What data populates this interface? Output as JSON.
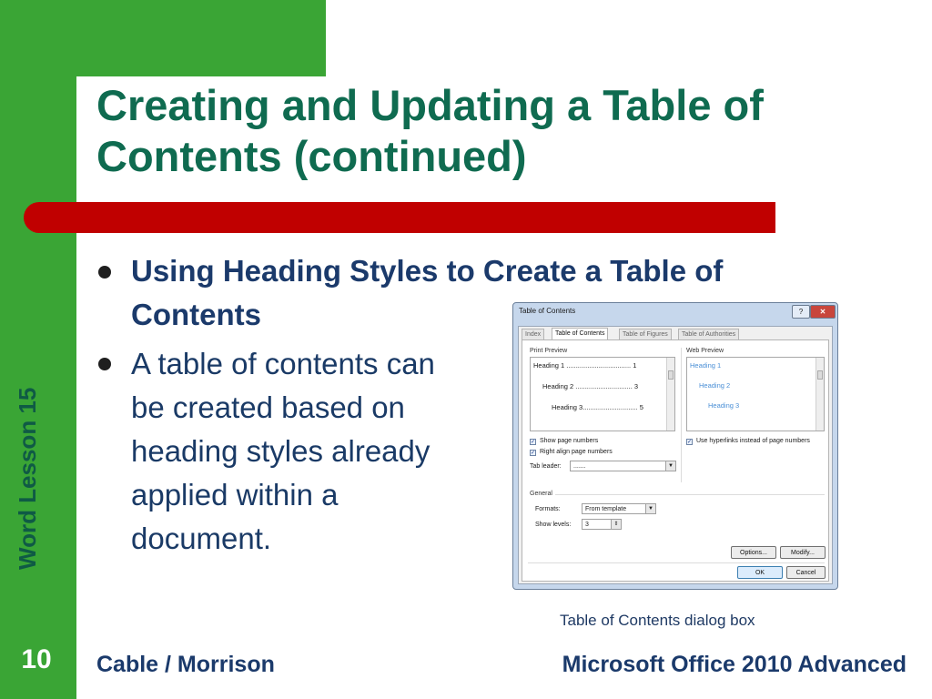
{
  "slide": {
    "title": "Creating and Updating a Table of Contents (continued)",
    "side_label": "Word Lesson 15",
    "bullets": [
      {
        "text": "Using Heading Styles to Create a Table of Contents"
      },
      {
        "text": "A table of contents can be created based on heading styles already applied within a document."
      }
    ],
    "caption": "Table of Contents dialog box",
    "page_number": "10",
    "footer_left": "Cable / Morrison",
    "footer_right": "Microsoft Office 2010 Advanced"
  },
  "dialog": {
    "title": "Table of Contents",
    "help_glyph": "?",
    "close_glyph": "✕",
    "tabs": [
      {
        "label": "Index",
        "active": false
      },
      {
        "label": "Table of Contents",
        "active": true
      },
      {
        "label": "Table of Figures",
        "active": false
      },
      {
        "label": "Table of Authorities",
        "active": false
      }
    ],
    "print_preview": {
      "label": "Print Preview",
      "lines": [
        "Heading 1 .................................. 1",
        "Heading 2 .............................. 3",
        "Heading 3............................. 5"
      ]
    },
    "web_preview": {
      "label": "Web Preview",
      "lines": [
        "Heading 1",
        "Heading 2",
        "Heading 3"
      ]
    },
    "show_page_numbers": "Show page numbers",
    "right_align": "Right align page numbers",
    "tab_leader_label": "Tab leader:",
    "tab_leader_value": ".......",
    "use_hyperlinks": "Use hyperlinks instead of page numbers",
    "general_label": "General",
    "formats_label": "Formats:",
    "formats_value": "From template",
    "show_levels_label": "Show levels:",
    "show_levels_value": "3",
    "options_button": "Options...",
    "modify_button": "Modify...",
    "ok_button": "OK",
    "cancel_button": "Cancel"
  },
  "colors": {
    "green": "#3aa535",
    "red": "#c00000",
    "title": "#0f6b50",
    "text": "#1b3a6b"
  }
}
